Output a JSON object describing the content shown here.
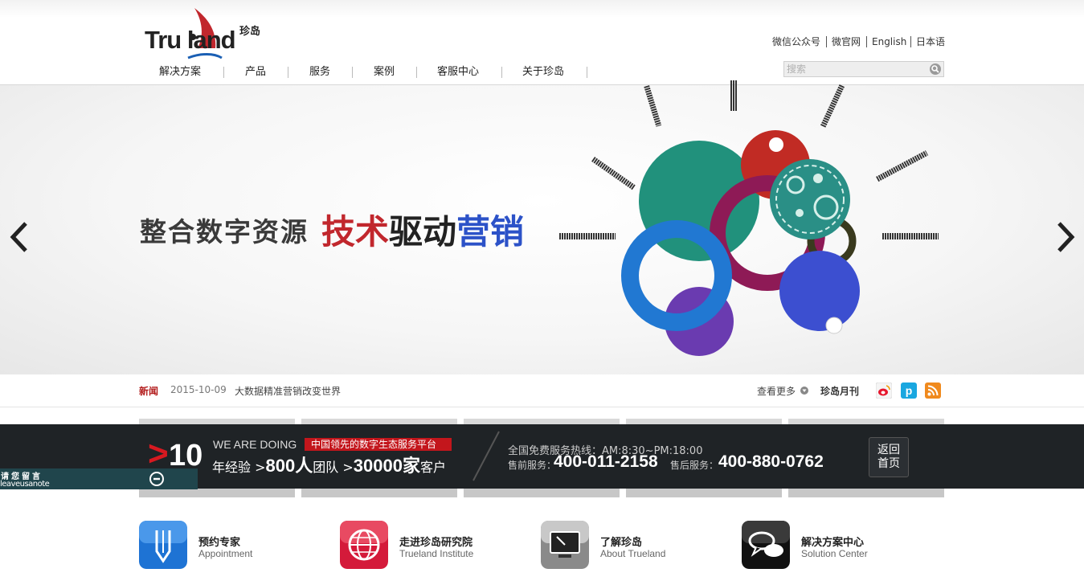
{
  "header": {
    "logo_text": "Tru land",
    "logo_cn": "珍岛",
    "nav": [
      "解决方案",
      "产品",
      "服务",
      "案例",
      "客服中心",
      "关于珍岛"
    ],
    "top_links": [
      "微信公众号",
      "微官网",
      "English",
      "日本语"
    ],
    "search_placeholder": "搜索"
  },
  "banner": {
    "slogan_left": "整合数字资源",
    "slogan_red": "技术",
    "slogan_black": "驱动",
    "slogan_blue": "营销",
    "prev_icon": "chevron-left-icon",
    "next_icon": "chevron-right-icon"
  },
  "news": {
    "label": "新闻",
    "date": "2015-10-09",
    "title": "大数据精准营销改变世界",
    "more": "查看更多",
    "monthly": "珍岛月刊",
    "social_icons": [
      "weibo-icon",
      "pp-icon",
      "rss-icon"
    ]
  },
  "contact_bar": {
    "gt_symbol": ">",
    "years": "10",
    "we_are_doing": "WE ARE DOING",
    "tagline": "中国领先的数字生态服务平台",
    "years_unit": "年经验",
    "gt1": ">",
    "team_num": "800",
    "team_unit": "人",
    "team_label": "团队",
    "gt2": ">",
    "client_num": "30000",
    "client_unit": "家",
    "client_label": "客户",
    "hotline_title": "全国免费服务热线：AM:8:30~PM:18:00",
    "pre_sale_label": "售前服务：",
    "pre_sale_phone": "400-011-2158",
    "after_sale_label": "售后服务：",
    "after_sale_phone": "400-880-0762",
    "back_home_line1": "返回",
    "back_home_line2": "首页"
  },
  "leave_note": {
    "cn": "请您留言",
    "en": "leaveusanote"
  },
  "features": [
    {
      "cn": "预约专家",
      "en": "Appointment",
      "icon": "pen-icon",
      "color": "#1e73d4"
    },
    {
      "cn": "走进珍岛研究院",
      "en": "Trueland Institute",
      "icon": "globe-icon",
      "color": "#d41a3a"
    },
    {
      "cn": "了解珍岛",
      "en": "About Trueland",
      "icon": "monitor-icon",
      "color": "#8a8a8a"
    },
    {
      "cn": "解决方案中心",
      "en": "Solution Center",
      "icon": "chat-bubbles-icon",
      "color": "#111111"
    }
  ]
}
